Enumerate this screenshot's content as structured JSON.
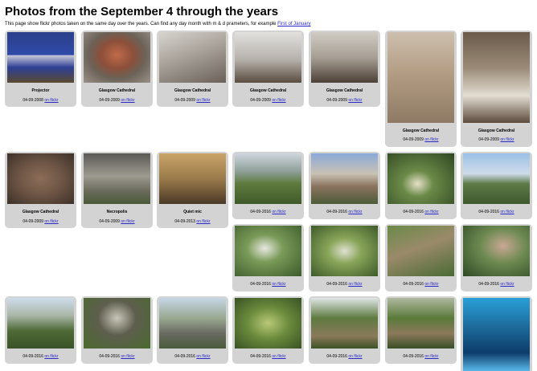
{
  "page": {
    "title": "Photos from the September 4 through the years",
    "intro_text": "This page show flickr photos taken on the same day over the years. Can find any day month with m & d prameters, for example ",
    "intro_link": "First of January"
  },
  "photos": [
    {
      "title": "Projector",
      "date": "04-09-2008",
      "link": "on flickr",
      "bg": "linear-gradient(#2c3f8a 0%, #2f4aa8 45%, #c9c9d8 46%, #2d3f95 70%, #5a4a2f 100%)"
    },
    {
      "title": "Glasgow Cathedral",
      "date": "04-09-2009",
      "link": "on flickr",
      "bg": "radial-gradient(ellipse at 50% 45%, #c06a4a 0%, #8c4f3a 35%, #6b6258 60%, #9a9288 100%)"
    },
    {
      "title": "Glasgow Cathedral",
      "date": "04-09-2009",
      "link": "on flickr",
      "bg": "linear-gradient(160deg, #d7d4cf 0%, #a9a29a 45%, #6a625a 100%)"
    },
    {
      "title": "Glasgow Cathedral",
      "date": "04-09-2009",
      "link": "on flickr",
      "bg": "linear-gradient(180deg, #e2e1de 0%, #b5b0aa 55%, #5a4c40 100%)"
    },
    {
      "title": "Glasgow Cathedral",
      "date": "04-09-2009",
      "link": "on flickr",
      "bg": "linear-gradient(180deg, #d0cbc4 0%, #a79f95 50%, #4c4036 100%)"
    },
    {
      "title": "Glasgow Cathedral",
      "date": "04-09-2009",
      "link": "on flickr",
      "bg": "linear-gradient(180deg, #cdbfae 0%, #b39d84 45%, #8e7a64 100%)"
    },
    {
      "title": "Glasgow Cathedral",
      "date": "04-09-2009",
      "link": "on flickr",
      "bg": "linear-gradient(180deg, #6b5a4a 0%, #9b8b78 40%, #e3ddd2 70%, #5c4b3d 100%)"
    },
    {
      "title": "Glasgow Cathedral",
      "date": "04-09-2009",
      "link": "on flickr",
      "bg": "radial-gradient(ellipse at 50% 50%, #8c6d58 0%, #6e5646 45%, #3e3129 100%)"
    },
    {
      "title": "Necropolis",
      "date": "04-09-2009",
      "link": "on flickr",
      "bg": "linear-gradient(180deg, #5b5a55 0%, #9d9a91 45%, #6a6a5a 75%, #4a5a3a 100%)"
    },
    {
      "title": "Quiet mic",
      "date": "04-09-2013",
      "link": "on flickr",
      "bg": "linear-gradient(180deg, #caa56a 0%, #9a7a4a 50%, #4a3a28 100%)"
    },
    {
      "title": "",
      "date": "04-09-2016",
      "link": "on flickr",
      "bg": "linear-gradient(180deg, #cfd6de 0%, #8fa09a 35%, #5e7a3c 60%, #3f5a2a 100%)"
    },
    {
      "title": "",
      "date": "04-09-2016",
      "link": "on flickr",
      "bg": "linear-gradient(180deg, #8aa9d8 0%, #c9c2b4 40%, #8a7460 65%, #4d5a38 100%)"
    },
    {
      "title": "",
      "date": "04-09-2016",
      "link": "on flickr",
      "bg": "radial-gradient(ellipse at 45% 60%, #e6e0c8 0%, #6b8a48 30%, #2f4622 100%)"
    },
    {
      "title": "",
      "date": "04-09-2016",
      "link": "on flickr",
      "bg": "linear-gradient(180deg, #9cc0e6 0%, #cfdceb 40%, #5e7a48 60%, #3e5a2e 100%)"
    },
    {
      "title": "",
      "date": "04-09-2016",
      "link": "on flickr",
      "bg": "radial-gradient(ellipse at 45% 45%, #e8e8e0 0%, #7a9a58 35%, #3a5a2c 100%)"
    },
    {
      "title": "",
      "date": "04-09-2016",
      "link": "on flickr",
      "bg": "radial-gradient(ellipse at 50% 50%, #e0e0d2 0%, #8aa65a 35%, #3d5a2a 100%)"
    },
    {
      "title": "",
      "date": "04-09-2016",
      "link": "on flickr",
      "bg": "linear-gradient(160deg, #6a8a48 0%, #9a8a6a 45%, #4a6a34 100%)"
    },
    {
      "title": "",
      "date": "04-09-2016",
      "link": "on flickr",
      "bg": "radial-gradient(ellipse at 60% 40%, #c9a894 0%, #6e8a52 40%, #2f4a24 100%)"
    },
    {
      "title": "",
      "date": "04-09-2016",
      "link": "on flickr",
      "bg": "linear-gradient(180deg, #cfdcea 0%, #a9b6a8 35%, #4e6a36 65%, #3a5228 100%)"
    },
    {
      "title": "",
      "date": "04-09-2016",
      "link": "on flickr",
      "bg": "radial-gradient(ellipse at 50% 40%, #c8c6b8 0%, #5e5e4e 40%, #4a6a2e 100%)"
    },
    {
      "title": "",
      "date": "04-09-2016",
      "link": "on flickr",
      "bg": "linear-gradient(180deg, #c6d6e6 0%, #98a890 40%, #6a6a62 70%, #4a5a3a 100%)"
    },
    {
      "title": "",
      "date": "04-09-2016",
      "link": "on flickr",
      "bg": "radial-gradient(ellipse at 50% 50%, #b9c878 0%, #6a8a3c 45%, #3a5224 100%)"
    },
    {
      "title": "",
      "date": "04-09-2016",
      "link": "on flickr",
      "bg": "linear-gradient(180deg, #e0e6e6 0%, #5e7a40 40%, #8a7a5a 75%, #3e5226 100%)"
    },
    {
      "title": "",
      "date": "04-09-2016",
      "link": "on flickr",
      "bg": "linear-gradient(180deg, #b0b8a0 0%, #5a7a3a 40%, #8c7a5c 70%, #3a4e26 100%)"
    },
    {
      "title": "",
      "date": "",
      "link": "",
      "bg": "linear-gradient(180deg, #2aa0d8 0%, #1c6a9a 40%, #0c3c6a 75%, #5ab8e8 100%)"
    }
  ]
}
